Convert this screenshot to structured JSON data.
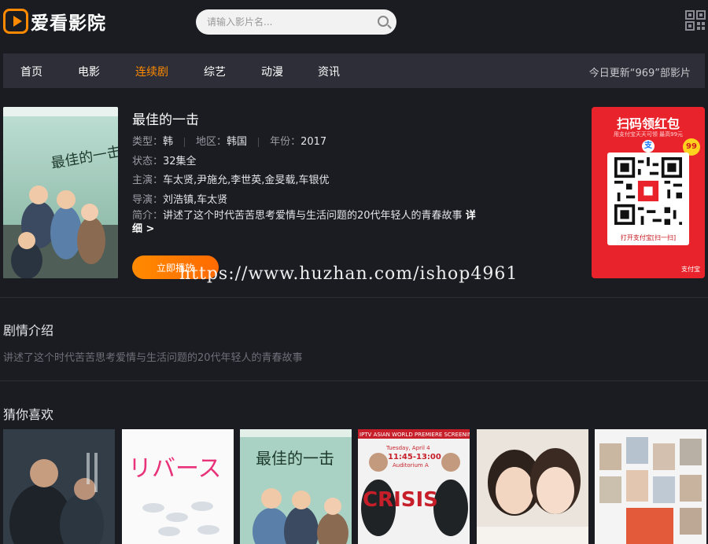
{
  "header": {
    "logo_text": "爱看影院",
    "search_placeholder": "请输入影片名...",
    "icons": [
      "logo-play-icon",
      "search-icon",
      "qr-code-icon"
    ]
  },
  "nav": {
    "items": [
      "首页",
      "电影",
      "连续剧",
      "综艺",
      "动漫",
      "资讯"
    ],
    "active": "连续剧",
    "update_text": "今日更新“969”部影片"
  },
  "detail": {
    "title": "最佳的一击",
    "type_label": "类型：",
    "type_value": "韩",
    "region_label": "地区：",
    "region_value": "韩国",
    "year_label": "年份：",
    "year_value": "2017",
    "status_label": "状态：",
    "status_value": "32集全",
    "cast_label": "主演：",
    "cast_value": "车太贤,尹施允,李世英,金旻载,车银优",
    "director_label": "导演：",
    "director_value": "刘浩镇,车太贤",
    "intro_label": "简介：",
    "intro_value": "讲述了这个时代苦苦思考爱情与生活问题的20代年轻人的青春故事",
    "more_label": "详细 >",
    "play_button": "立即播放",
    "poster_title": "最佳的一击"
  },
  "ad": {
    "title": "扫码领红包",
    "subtitle": "用支付宝天天可领 最高99元",
    "badge": "99",
    "scan_label": "打开支付宝[扫一扫]",
    "brand": "支付宝",
    "accent": "#e8232b"
  },
  "watermark": "https://www.huzhan.com/ishop4961",
  "plot_section": {
    "title": "剧情介绍",
    "text": "讲述了这个时代苦苦思考爱情与生活问题的20代年轻人的青春故事"
  },
  "recommend_section": {
    "title": "猜你喜欢",
    "items": [
      {
        "poster_text": ""
      },
      {
        "poster_text": "リバース"
      },
      {
        "poster_text": "最佳的一击"
      },
      {
        "poster_text": "CRISIS"
      },
      {
        "poster_text": ""
      },
      {
        "poster_text": ""
      }
    ],
    "crisis_banner": "IPTV ASIAN WORLD PREMIERE SCREENIN",
    "crisis_date": "Tuesday, April 4",
    "crisis_time": "11:45-13:00",
    "crisis_venue": "Auditorium A"
  },
  "colors": {
    "background": "#1b1c22",
    "nav_bg": "#2d2e37",
    "accent": "#ff8a00"
  }
}
